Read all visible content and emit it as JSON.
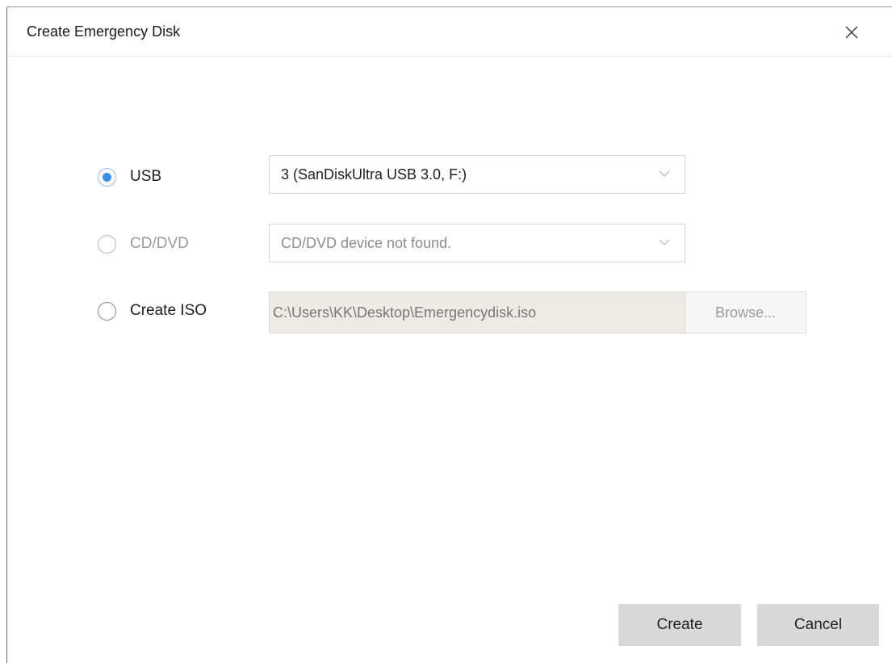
{
  "window": {
    "title": "Create Emergency Disk",
    "close_icon": "close-icon"
  },
  "options": {
    "usb": {
      "label": "USB",
      "selected": true,
      "device": "3 (SanDiskUltra USB 3.0, F:)"
    },
    "cddvd": {
      "label": "CD/DVD",
      "selected": false,
      "enabled": false,
      "device": "CD/DVD device not found."
    },
    "iso": {
      "label": "Create ISO",
      "selected": false,
      "path": "C:\\Users\\KK\\Desktop\\Emergencydisk.iso",
      "browse_label": "Browse..."
    }
  },
  "buttons": {
    "create": "Create",
    "cancel": "Cancel"
  },
  "colors": {
    "accent": "#3d8ee6",
    "button_bg": "#d9d9d9",
    "disabled_field_bg": "#ecebe6"
  }
}
